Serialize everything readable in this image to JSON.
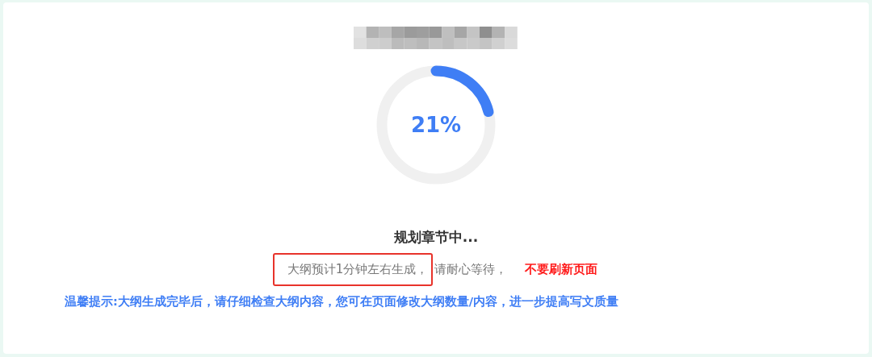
{
  "progress": {
    "level": 0.21,
    "label": "21%"
  },
  "status": {
    "heading": "规划章节中...",
    "segments": [
      {
        "text": "大纲预计1分钟左右生成，",
        "kind": "plain",
        "boxed": true
      },
      {
        "text": "请耐心等待，",
        "kind": "plain",
        "boxed": false
      },
      {
        "text": "不要刷新页面",
        "kind": "warning",
        "boxed": false
      }
    ]
  },
  "tip": "温馨提示:大纲生成完毕后，请仔细检查大纲内容，您可在页面修改大纲数量/内容，进一步提高写文质量"
}
